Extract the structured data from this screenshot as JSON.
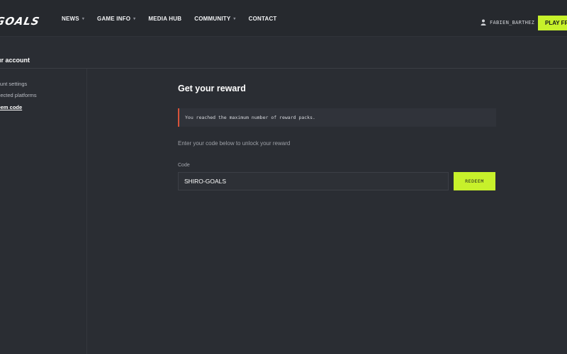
{
  "header": {
    "logo_text": "GOALS",
    "nav": [
      {
        "label": "NEWS",
        "has_dropdown": true
      },
      {
        "label": "GAME INFO",
        "has_dropdown": true
      },
      {
        "label": "MEDIA HUB",
        "has_dropdown": false
      },
      {
        "label": "COMMUNITY",
        "has_dropdown": true
      },
      {
        "label": "CONTACT",
        "has_dropdown": false
      }
    ],
    "caret_icon": "▾",
    "user": {
      "name": "FABIEN_BARTHEZ",
      "icon": "user-icon"
    },
    "play_label": "PLAY FREE N"
  },
  "account": {
    "title": "ur account"
  },
  "sidebar": {
    "items": [
      {
        "label": "count settings",
        "active": false
      },
      {
        "label": "nnected platforms",
        "active": false
      },
      {
        "label": "deem code",
        "active": true
      }
    ]
  },
  "main": {
    "title": "Get your reward",
    "alert": "You reached the maximum number of reward packs.",
    "helper": "Enter your code below to unlock your reward",
    "code_label": "Code",
    "code_value": "SHIRO-GOALS",
    "redeem_label": "REDEEM"
  },
  "colors": {
    "accent": "#c7f12b",
    "alert_bar": "#d9533a",
    "background": "#2a2d33"
  }
}
